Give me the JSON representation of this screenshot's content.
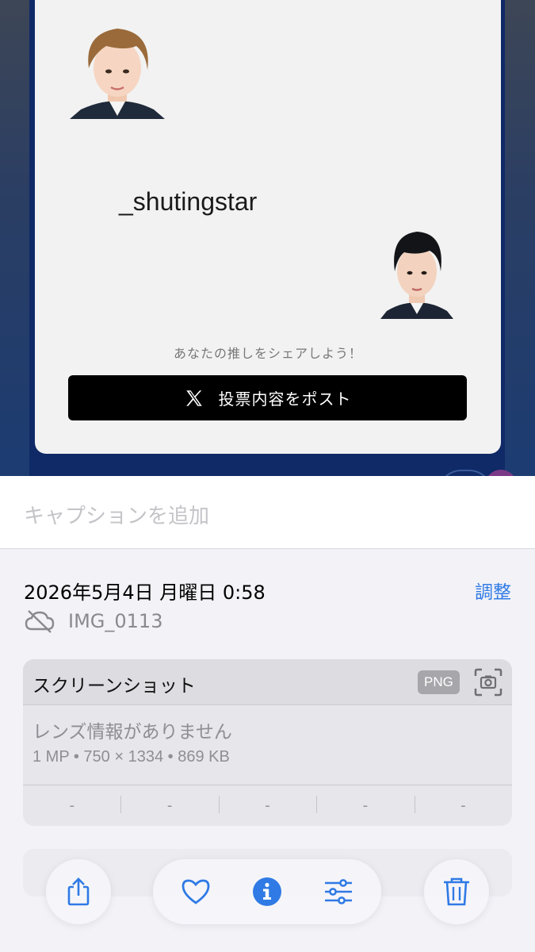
{
  "photo": {
    "username": "_shutingstar",
    "share_prompt": "あなたの推しをシェアしよう！",
    "post_button_label": "投票内容をポスト"
  },
  "caption": {
    "placeholder": "キャプションを追加"
  },
  "info": {
    "datetime": "2026年5月4日 月曜日 0:58",
    "adjust_label": "調整",
    "filename": "IMG_0113",
    "meta": {
      "title": "スクリーンショット",
      "format_badge": "PNG",
      "lens_text": "レンズ情報がありません",
      "spec_text": "1 MP • 750 × 1334 • 869 KB",
      "exif_values": [
        "-",
        "-",
        "-",
        "-",
        "-"
      ]
    }
  },
  "colors": {
    "accent": "#2f7ae5",
    "icon_blue": "#2f7ae5"
  },
  "toolbar": {
    "icons": [
      "share-icon",
      "heart-icon",
      "info-icon",
      "adjust-icon",
      "trash-icon"
    ]
  }
}
